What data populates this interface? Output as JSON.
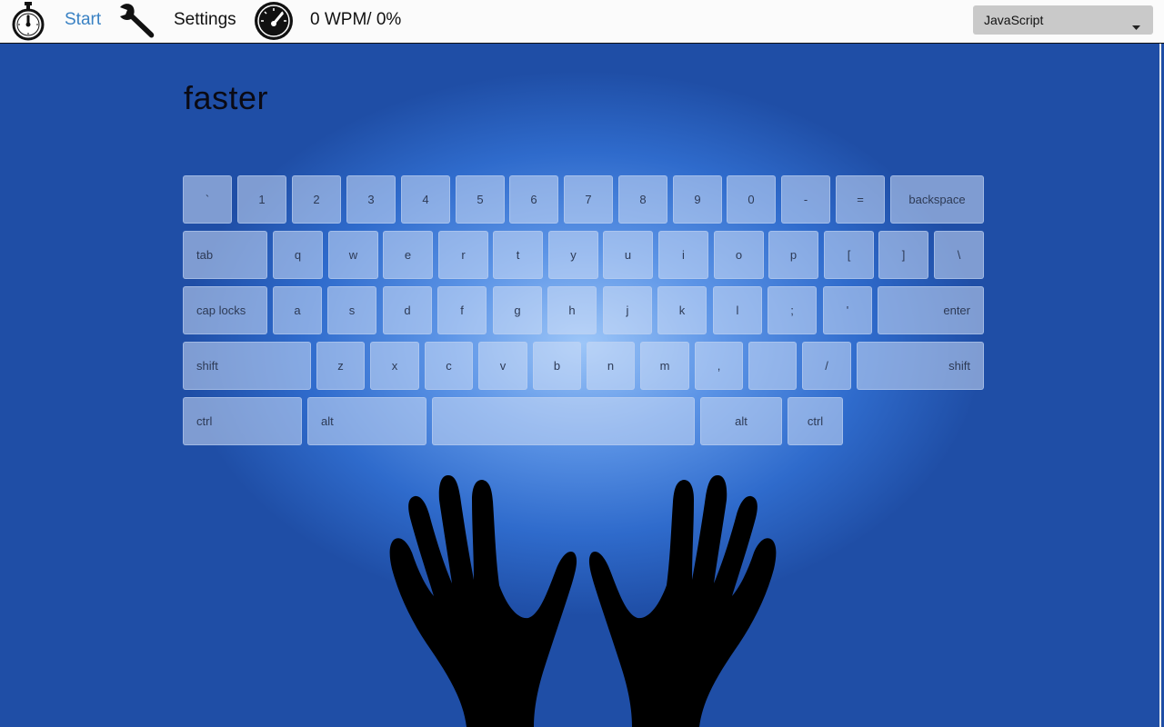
{
  "toolbar": {
    "start_label": "Start",
    "settings_label": "Settings",
    "stats": "0 WPM/ 0%",
    "language": "JavaScript"
  },
  "icons": {
    "timer": "stopwatch-icon",
    "settings": "wrench-icon",
    "speed": "speedometer-icon",
    "dropdown": "chevron-down-icon",
    "hands": "hands-illustration"
  },
  "target_word": "faster",
  "keyboard": {
    "rows": [
      [
        "`",
        "1",
        "2",
        "3",
        "4",
        "5",
        "6",
        "7",
        "8",
        "9",
        "0",
        "-",
        "=",
        "backspace"
      ],
      [
        "tab",
        "q",
        "w",
        "e",
        "r",
        "t",
        "y",
        "u",
        "i",
        "o",
        "p",
        "[",
        "]",
        "\\"
      ],
      [
        "cap locks",
        "a",
        "s",
        "d",
        "f",
        "g",
        "h",
        "j",
        "k",
        "l",
        ";",
        "'",
        "enter"
      ],
      [
        "shift",
        "z",
        "x",
        "c",
        "v",
        "b",
        "n",
        "m",
        ",",
        "",
        "/",
        "shift"
      ],
      [
        "ctrl",
        "alt",
        "",
        "alt",
        "ctrl"
      ]
    ]
  },
  "colors": {
    "start_link": "#3a82c4",
    "background": "#1f4ea6",
    "glow": "#9dc6f8"
  }
}
